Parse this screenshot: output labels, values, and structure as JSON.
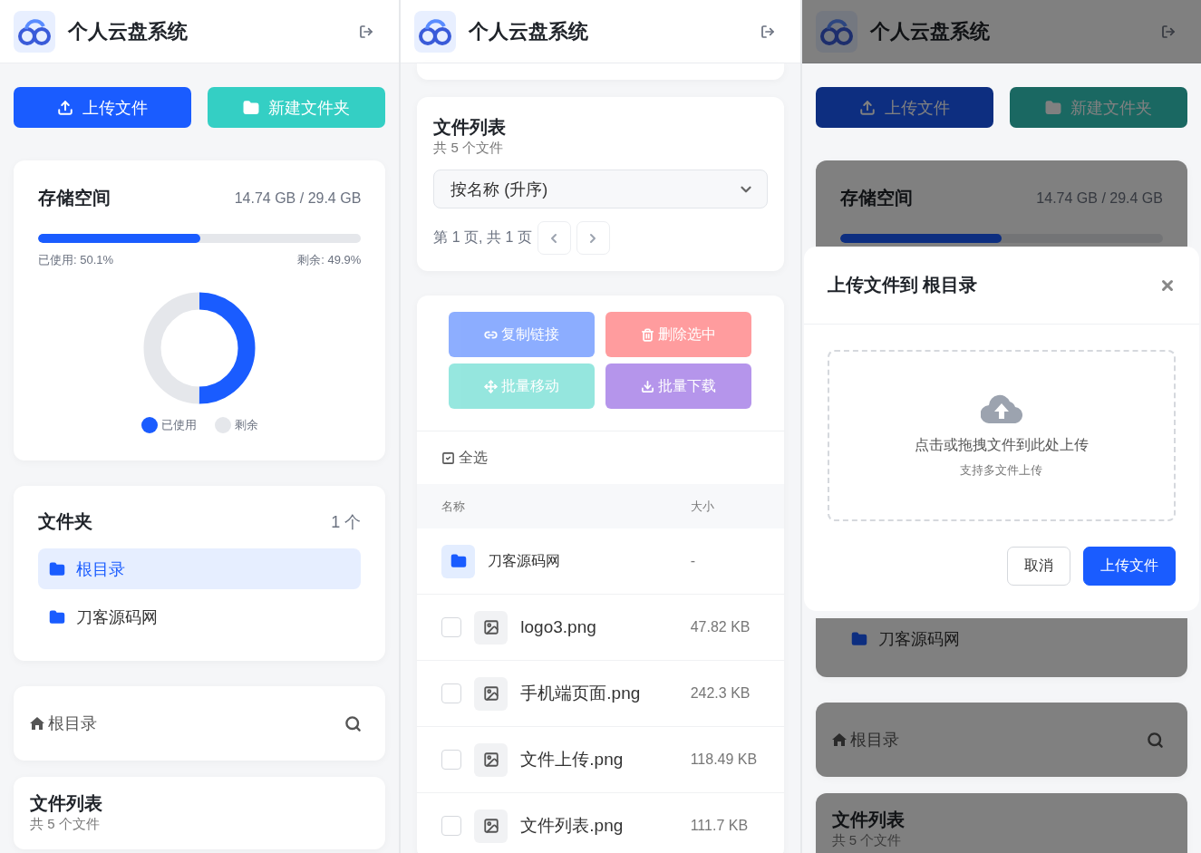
{
  "screens": [
    {
      "kind": "main",
      "header_title": "个人云盘系统",
      "actions": [
        {
          "kind": "upload",
          "label": "上传文件"
        },
        {
          "kind": "new_folder",
          "label": "新建文件夹"
        }
      ],
      "storage": {
        "title": "存储空间",
        "usage": "14.74 GB / 29.4 GB",
        "level": 0.501,
        "used": "已使用: 50.1%",
        "free": "剩余: 49.9%",
        "legend": [
          {
            "label": "已使用",
            "color": "#1a5cff"
          },
          {
            "label": "剩余",
            "color": "#e5e7eb"
          }
        ]
      },
      "folders": {
        "title": "文件夹",
        "count": "1 个",
        "items": [
          {
            "label": "根目录",
            "selected": true
          },
          {
            "label": "刀客源码网",
            "selected": false
          }
        ]
      },
      "breadcrumb": "根目录",
      "file_list": {
        "title": "文件列表",
        "count": "共 5 个文件"
      }
    },
    {
      "kind": "list",
      "header_title": "个人云盘系统",
      "file_list": {
        "title": "文件列表",
        "count": "共 5 个文件",
        "sort": "按名称 (升序)",
        "page_info": "第 1 页, 共 1 页"
      },
      "batch_actions": [
        {
          "kind": "copy_link",
          "label": "复制链接",
          "disabled": true
        },
        {
          "kind": "delete",
          "label": "删除选中",
          "disabled": true
        },
        {
          "kind": "move",
          "label": "批量移动",
          "disabled": true
        },
        {
          "kind": "download",
          "label": "批量下载",
          "disabled": true
        }
      ],
      "select_all": "全选",
      "columns": [
        "名称",
        "大小"
      ],
      "rows": [
        {
          "kind": "folder",
          "name": "刀客源码网",
          "size": "-"
        },
        {
          "kind": "file",
          "name": "logo3.png",
          "size": "47.82 KB",
          "checked": false
        },
        {
          "kind": "file",
          "name": "手机端页面.png",
          "size": "242.3 KB",
          "checked": false
        },
        {
          "kind": "file",
          "name": "文件上传.png",
          "size": "118.49 KB",
          "checked": false
        },
        {
          "kind": "file",
          "name": "文件列表.png",
          "size": "111.7 KB",
          "checked": false
        }
      ]
    },
    {
      "kind": "dialog",
      "header_title": "个人云盘系统",
      "actions": [
        {
          "kind": "upload",
          "label": "上传文件"
        },
        {
          "kind": "new_folder",
          "label": "新建文件夹"
        }
      ],
      "storage": {
        "title": "存储空间",
        "usage": "14.74 GB / 29.4 GB",
        "level": 0.501
      },
      "dialog": {
        "title": "上传文件到 根目录",
        "drop_text": "点击或拖拽文件到此处上传",
        "drop_hint": "支持多文件上传",
        "buttons": [
          {
            "kind": "cancel",
            "label": "取消"
          },
          {
            "kind": "primary",
            "label": "上传文件"
          }
        ]
      },
      "folders": {
        "items": [
          {
            "label": "刀客源码网",
            "selected": false
          }
        ]
      },
      "breadcrumb": "根目录",
      "file_list": {
        "title": "文件列表",
        "count": "共 5 个文件"
      }
    }
  ]
}
